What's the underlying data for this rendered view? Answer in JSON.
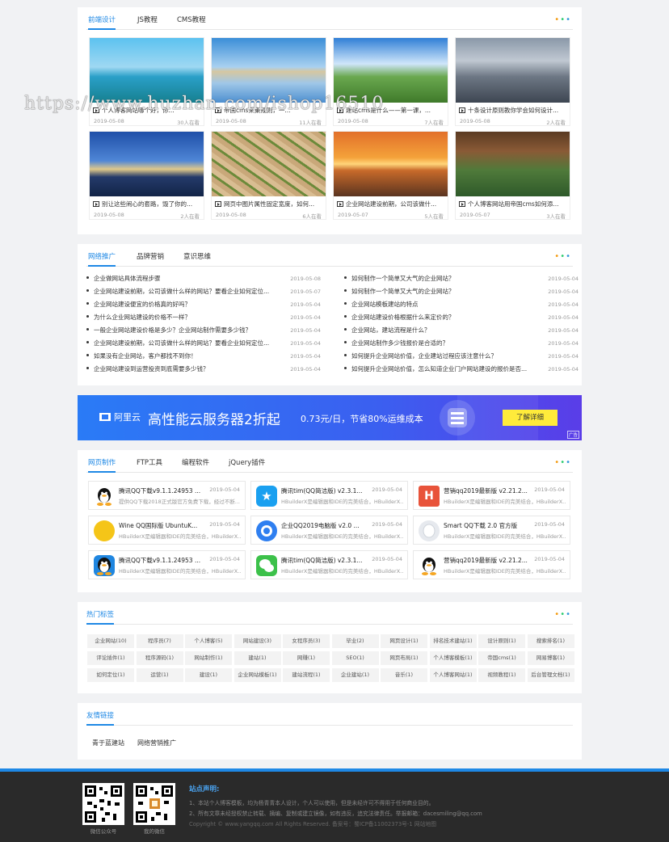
{
  "section1": {
    "tabs": [
      "前端设计",
      "JS教程",
      "CMS教程"
    ],
    "tiles": [
      {
        "title": "个人博客网站哪个好，你...",
        "date": "2019-05-08",
        "views": "30人在看"
      },
      {
        "title": "帝国cms采集规则，一...",
        "date": "2019-05-08",
        "views": "11人在看"
      },
      {
        "title": "建站cms是什么——第一课，...",
        "date": "2019-05-08",
        "views": "7人在看"
      },
      {
        "title": "十条设计原则教你学会如何设计...",
        "date": "2019-05-08",
        "views": "2人在看"
      },
      {
        "title": "别让这些闹心的套路，毁了你的...",
        "date": "2019-05-08",
        "views": "2人在看"
      },
      {
        "title": "网页中图片属性固定宽度，如何...",
        "date": "2019-05-08",
        "views": "6人在看"
      },
      {
        "title": "企业网站建设前期，公司该做什...",
        "date": "2019-05-07",
        "views": "5人在看"
      },
      {
        "title": "个人博客网站用帝国cms如何添...",
        "date": "2019-05-07",
        "views": "3人在看"
      }
    ]
  },
  "section2": {
    "tabs": [
      "网络推广",
      "品牌营销",
      "意识思维"
    ],
    "left": [
      {
        "t": "企业做网站具体流程步骤",
        "d": "2019-05-08"
      },
      {
        "t": "企业网站建设前期，公司该做什么样的网站？要看企业如何定位...",
        "d": "2019-05-07"
      },
      {
        "t": "企业网站建设便宜的价格真的好吗？",
        "d": "2019-05-04"
      },
      {
        "t": "为什么企业网站建设的价格不一样？",
        "d": "2019-05-04"
      },
      {
        "t": "一般企业网站建设价格是多少？企业网站制作需要多少钱？",
        "d": "2019-05-04"
      },
      {
        "t": "企业网站建设前期，公司该做什么样的网站？要看企业如何定位...",
        "d": "2019-05-04"
      },
      {
        "t": "如果没有企业网站，客户都找不到你！",
        "d": "2019-05-04"
      },
      {
        "t": "企业网站建设到运营投资到底需要多少钱？",
        "d": "2019-05-04"
      }
    ],
    "right": [
      {
        "t": "如何制作一个简单又大气的企业网站？",
        "d": "2019-05-04"
      },
      {
        "t": "如何制作一个简单又大气的企业网站？",
        "d": "2019-05-04"
      },
      {
        "t": "企业网站模板建站的特点",
        "d": "2019-05-04"
      },
      {
        "t": "企业网站建设价格根据什么来定价的？",
        "d": "2019-05-04"
      },
      {
        "t": "企业网站，建站流程是什么？",
        "d": "2019-05-04"
      },
      {
        "t": "企业网站制作多少钱报价是合适的？",
        "d": "2019-05-04"
      },
      {
        "t": "如何提升企业网站价值，企业建站过程应该注意什么？",
        "d": "2019-05-04"
      },
      {
        "t": "如何提升企业网站价值，怎么知道企业门户网站建设的报价是否...",
        "d": "2019-05-04"
      }
    ]
  },
  "banner": {
    "brand": "阿里云",
    "headline": "高性能云服务器2折起",
    "sub": "0.73元/日，节省80%运维成本",
    "button": "了解详细",
    "ad": "广告"
  },
  "section3": {
    "tabs": [
      "网页制作",
      "FTP工具",
      "编程软件",
      "jQuery插件"
    ],
    "items": [
      {
        "name": "腾讯QQ下载v9.1.1.24953 ...",
        "date": "2019-05-04",
        "desc": "提供QQ下载2018正式版官方免费下载，经过不断...",
        "icon": "qq-penguin-icon",
        "color": "#ffffff"
      },
      {
        "name": "腾讯tim(QQ简洁版) v2.3.1...",
        "date": "2019-05-04",
        "desc": "HBuilderX是编辑器和IDE的完美结合，HBuilderX...",
        "icon": "tim-star-icon",
        "color": "#1aa0f0"
      },
      {
        "name": "营销qq2019最新版 v2.21.2...",
        "date": "2019-05-04",
        "desc": "HBuilderX是编辑器和IDE的完美结合，HBuilderX...",
        "icon": "hbuilder-h-icon",
        "color": "#e8533a"
      },
      {
        "name": "Wine QQ国际版 UbuntuK...",
        "date": "2019-05-04",
        "desc": "HBuilderX是编辑器和IDE的完美结合，HBuilderX...",
        "icon": "wine-qq-icon",
        "color": "#f5c518"
      },
      {
        "name": "企业QQ2019电脑版 v2.0 ...",
        "date": "2019-05-04",
        "desc": "HBuilderX是编辑器和IDE的完美结合，HBuilderX...",
        "icon": "enterprise-qq-icon",
        "color": "#2f7ff0"
      },
      {
        "name": "Smart QQ下载 2.0 官方版",
        "date": "2019-05-04",
        "desc": "HBuilderX是编辑器和IDE的完美结合，HBuilderX...",
        "icon": "smart-qq-icon",
        "color": "#e6e9ee"
      },
      {
        "name": "腾讯QQ下载v9.1.1.24953 ...",
        "date": "2019-05-04",
        "desc": "HBuilderX是编辑器和IDE的完美结合，HBuilderX...",
        "icon": "qq-blue-icon",
        "color": "#1f86e0"
      },
      {
        "name": "腾讯tim(QQ简洁版) v2.3.1...",
        "date": "2019-05-04",
        "desc": "HBuilderX是编辑器和IDE的完美结合，HBuilderX...",
        "icon": "wechat-icon",
        "color": "#3cc14a"
      },
      {
        "name": "营销qq2019最新版 v2.21.2...",
        "date": "2019-05-04",
        "desc": "HBuilderX是编辑器和IDE的完美结合，HBuilderX...",
        "icon": "pirate-qq-icon",
        "color": "#ffffff"
      }
    ]
  },
  "tags": {
    "title": "热门标签",
    "items": [
      "企业网站(10)",
      "程序员(7)",
      "个人博客(5)",
      "网站建设(3)",
      "女程序员(3)",
      "毕业(2)",
      "网页设计(1)",
      "排名技术建站(1)",
      "设计原则(1)",
      "搜索排名(1)",
      "评论插件(1)",
      "程序源码(1)",
      "网站制作(1)",
      "建站(1)",
      "网赚(1)",
      "SEO(1)",
      "网页布局(1)",
      "个人博客模板(1)",
      "帝国cms(1)",
      "网易博客(1)",
      "如何定位(1)",
      "运营(1)",
      "建设(1)",
      "企业网站模板(1)",
      "建站流程(1)",
      "企业建站(1)",
      "音乐(1)",
      "个人博客网站(1)",
      "视频教程(1)",
      "后台管理文档(1)"
    ]
  },
  "links": {
    "title": "友情链接",
    "items": [
      "青于蓝建站",
      "网络营销推广"
    ]
  },
  "footer": {
    "qr1": "微信公众号",
    "qr2": "我的微信",
    "title": "站点声明:",
    "line1": "1、本站个人博客模板，均为杨青青本人设计，个人可以使用，但是未经许可不得用于任何商业目的。",
    "line2": "2、所有文章未经授权禁止转载、摘编、复制或建立镜像，如有违反，追究法律责任。举报邮箱：dacesmiling@qq.com",
    "line3": "Copyright © www.yangqq.com All Rights Reserved. 备案号：蜀ICP备11002373号-1 网站地图"
  },
  "watermark": "https://www.huzhan.com/ishop16510"
}
